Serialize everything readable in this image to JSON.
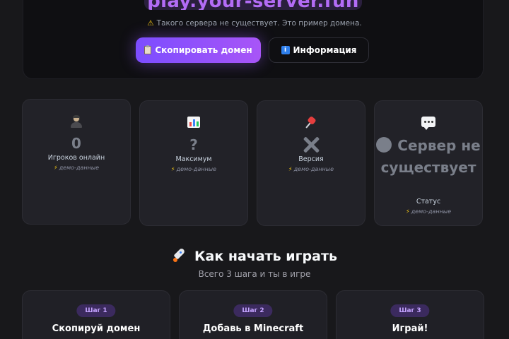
{
  "hero": {
    "domain": "play.your-server.fun",
    "warning_icon": "warning-icon",
    "warning": "Такого сервера не существует. Это пример домена.",
    "copy_button": "Скопировать домен",
    "info_button": "Информация",
    "accent_gradient": [
      "#7c4dff",
      "#a855f7"
    ]
  },
  "stats": [
    {
      "icon": "person-icon",
      "value": "0",
      "label": "Игроков онлайн",
      "demo": "демо-данные"
    },
    {
      "icon": "bar-chart-icon",
      "value": "?",
      "label": "Максимум",
      "demo": "демо-данные"
    },
    {
      "icon": "pushpin-icon",
      "value": "✕",
      "label": "Версия",
      "demo": "демо-данные"
    },
    {
      "icon": "chat-bubble-icon",
      "value": "Сервер не существует",
      "label": "Статус",
      "demo": "демо-данные"
    }
  ],
  "section": {
    "title": "Как начать играть",
    "subtitle": "Всего 3 шага и ты в игре"
  },
  "steps": [
    {
      "badge": "Шаг 1",
      "title": "Скопируй домен"
    },
    {
      "badge": "Шаг 2",
      "title": "Добавь в Minecraft"
    },
    {
      "badge": "Шаг 3",
      "title": "Играй!"
    }
  ]
}
